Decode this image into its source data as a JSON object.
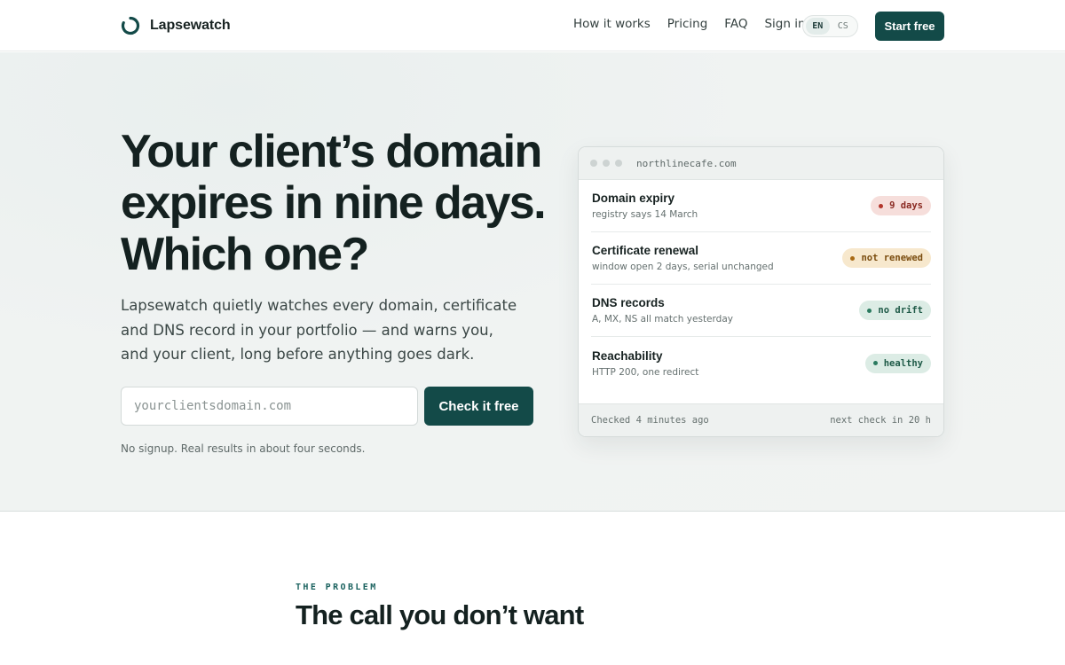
{
  "brand": {
    "name": "Lapsewatch"
  },
  "nav": {
    "links": [
      "How it works",
      "Pricing",
      "FAQ",
      "Sign in"
    ],
    "languages": [
      "EN",
      "CS"
    ],
    "active_language": "EN",
    "cta_label": "Start free"
  },
  "hero": {
    "title": "Your client’s domain expires in nine days. Which one?",
    "subtitle": "Lapsewatch quietly watches every domain, certificate and DNS record in your portfolio — and warns you, and your client, long before anything goes dark.",
    "input_placeholder": "yourclientsdomain.com",
    "input_value": "",
    "button_label": "Check it free",
    "note": "No signup. Real results in about four seconds."
  },
  "status_card": {
    "domain": "northlinecafe.com",
    "rows": [
      {
        "title": "Domain expiry",
        "detail": "registry says 14 March",
        "badge": "9 days",
        "status": "danger"
      },
      {
        "title": "Certificate renewal",
        "detail": "window open 2 days, serial unchanged",
        "badge": "not renewed",
        "status": "warning"
      },
      {
        "title": "DNS records",
        "detail": "A, MX, NS all match yesterday",
        "badge": "no drift",
        "status": "ok"
      },
      {
        "title": "Reachability",
        "detail": "HTTP 200, one redirect",
        "badge": "healthy",
        "status": "ok"
      }
    ],
    "footer_left": "Checked 4 minutes ago",
    "footer_right": "next check in 20 h"
  },
  "problem_section": {
    "eyebrow": "THE PROBLEM",
    "title": "The call you don’t want"
  },
  "colors": {
    "accent": "#134a48",
    "danger": "#b3352b",
    "warning": "#a86a14",
    "ok": "#2a7a5f"
  }
}
